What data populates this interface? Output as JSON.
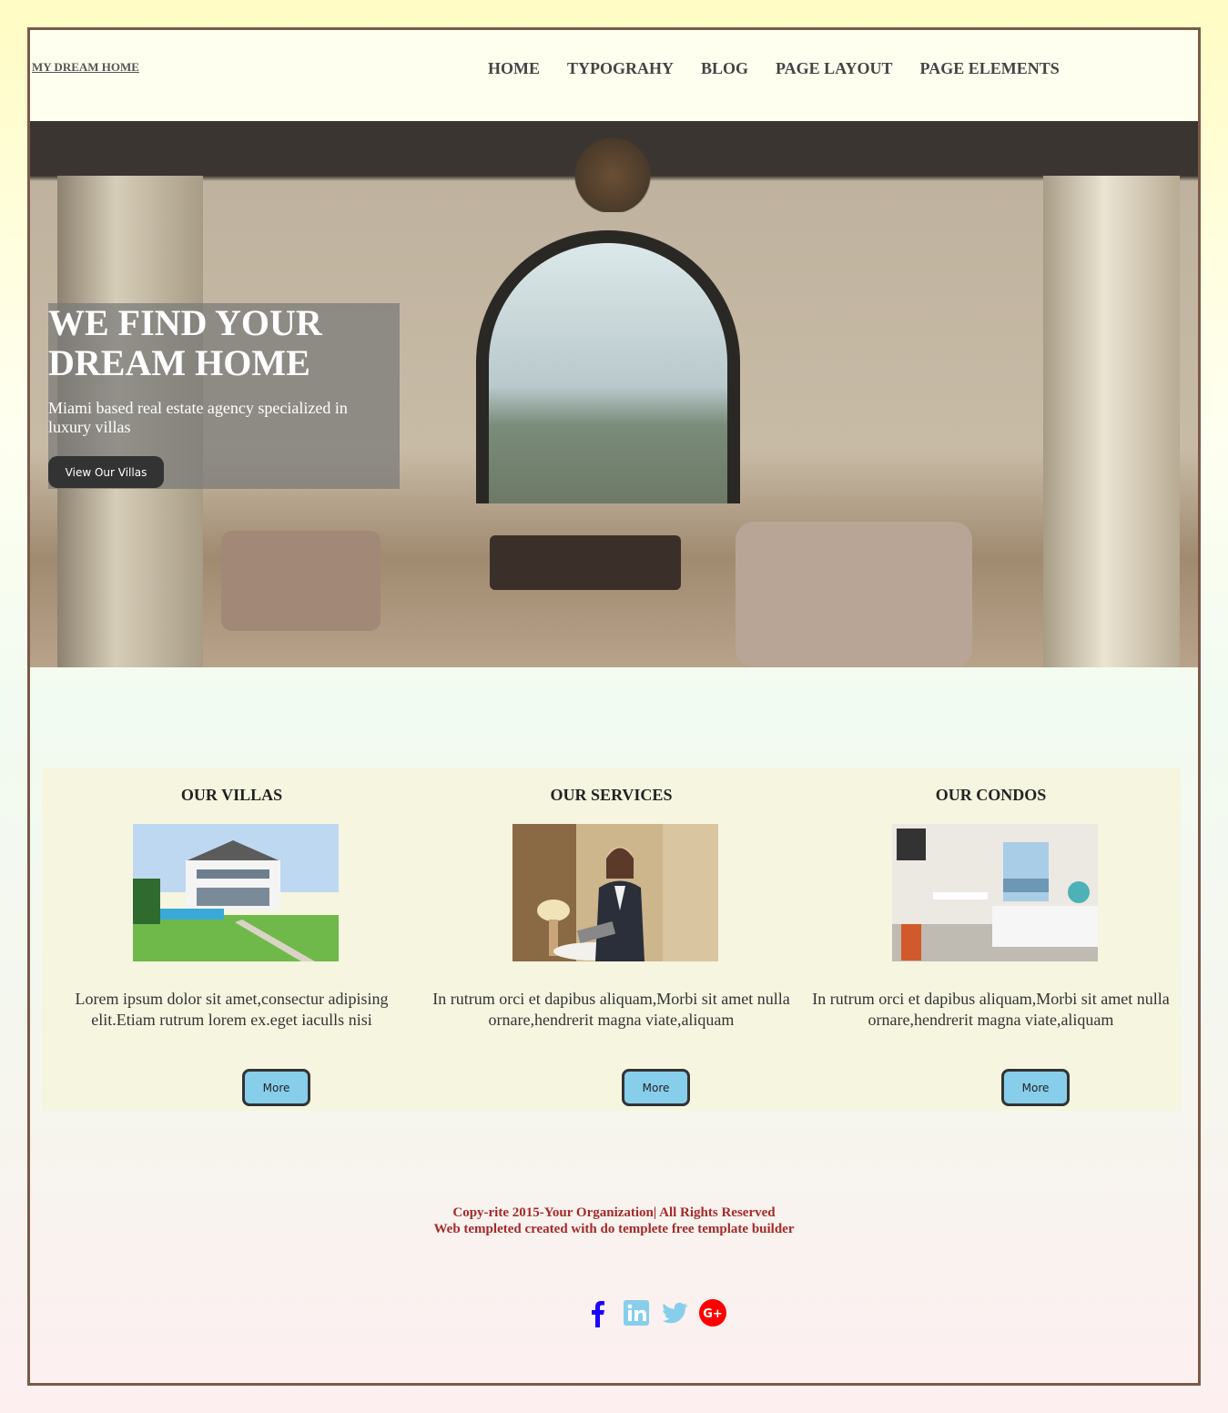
{
  "header": {
    "logo": "MY DREAM HOME",
    "nav": [
      "HOME",
      "TYPOGRAHY",
      "BLOG",
      "PAGE LAYOUT",
      "PAGE ELEMENTS"
    ]
  },
  "hero": {
    "title": "WE FIND YOUR DREAM HOME",
    "subtitle": "Miami based real estate agency specialized in luxury villas",
    "button": "View Our Villas"
  },
  "cards": [
    {
      "title": "OUR VILLAS",
      "text": "Lorem ipsum dolor sit amet,consectur adipising elit.Etiam rutrum lorem ex.eget iaculls nisi",
      "button": "More"
    },
    {
      "title": "OUR SERVICES",
      "text": "In rutrum orci et dapibus aliquam,Morbi sit amet nulla ornare,hendrerit magna viate,aliquam",
      "button": "More"
    },
    {
      "title": "OUR CONDOS",
      "text": "In rutrum orci et dapibus aliquam,Morbi sit amet nulla ornare,hendrerit magna viate,aliquam",
      "button": "More"
    }
  ],
  "footer": {
    "line1": "Copy-rite 2015-Your Organization| All Rights Reserved",
    "line2": "Web templeted created with do templete free template builder"
  },
  "social": [
    "facebook-icon",
    "linkedin-icon",
    "twitter-icon",
    "google-plus-icon"
  ],
  "colors": {
    "frame_border": "#7b5a48",
    "more_button": "#87ceeb",
    "footer_text": "#a52a2a",
    "facebook": "#1a00ff",
    "linkedin": "#87ceeb",
    "twitter": "#87ceeb",
    "google_plus": "#ff0000"
  }
}
